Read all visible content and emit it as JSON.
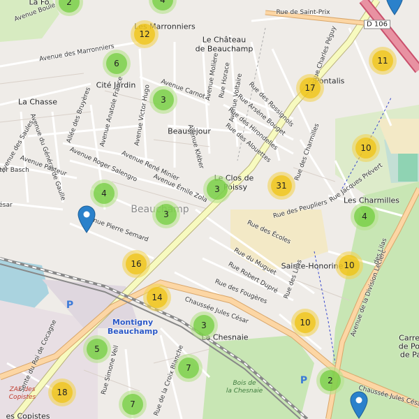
{
  "colors": {
    "green": "#6ecc39",
    "yellow": "#f0c20c",
    "pin": "#2a81cb",
    "road_major": "#f7fabf",
    "road_orange": "#fcd6a4",
    "rail": "#999999"
  },
  "places": [
    {
      "id": "marronniers",
      "text": "Les Marronniers"
    },
    {
      "id": "chateau1",
      "text": "Le Château"
    },
    {
      "id": "chateau2",
      "text": "de Beauchamp"
    },
    {
      "id": "citejardin",
      "text": "Cité Jardin"
    },
    {
      "id": "lachasse",
      "text": "La Chasse"
    },
    {
      "id": "beausejour",
      "text": "Beauséjour"
    },
    {
      "id": "leclos",
      "text": "Le Clos de"
    },
    {
      "id": "poissy",
      "text": "Poissy"
    },
    {
      "id": "pontalis",
      "text": "Pontalis"
    },
    {
      "id": "charmilles",
      "text": "Les Charmilles"
    },
    {
      "id": "honorine",
      "text": "Sainte-Honorine"
    },
    {
      "id": "chesnaie",
      "text": "La Chesnaie"
    },
    {
      "id": "carref1",
      "text": "Carref"
    },
    {
      "id": "carref2",
      "text": "de Pot"
    },
    {
      "id": "carref3",
      "text": "de Pa"
    },
    {
      "id": "lafo",
      "text": "La Fo"
    },
    {
      "id": "copistes",
      "text": "es Copistes"
    }
  ],
  "town_label": "Beauchamp",
  "station": [
    "Montigny",
    "Beauchamp"
  ],
  "wood": [
    "Bois de",
    "la Chesnaie"
  ],
  "zae": [
    "ZAE des",
    "Copistes"
  ],
  "road_shield": "D 106",
  "parking_symbol": "P",
  "streets": [
    {
      "id": "saintprix",
      "text": "Rue de Saint-Prix"
    },
    {
      "id": "marronniers_av",
      "text": "Avenue des Marronniers"
    },
    {
      "id": "boule",
      "text": "Avenue Boule"
    },
    {
      "id": "bruyeres",
      "text": "Allée des Bruyères"
    },
    {
      "id": "anatole",
      "text": "Avenue Anatole France"
    },
    {
      "id": "hugo",
      "text": "Avenue Victor Hugo"
    },
    {
      "id": "carnot",
      "text": "Avenue Carnot"
    },
    {
      "id": "moliere",
      "text": "Avenue Molière"
    },
    {
      "id": "horace",
      "text": "Rue Horace"
    },
    {
      "id": "voltaire",
      "text": "Avenue Voltaire"
    },
    {
      "id": "rossignols",
      "text": "Rue des Rossignols"
    },
    {
      "id": "arsene",
      "text": "Rue Arsène Bouget"
    },
    {
      "id": "hirondelles",
      "text": "Rue des Hirondelles"
    },
    {
      "id": "alouettes",
      "text": "Rue des Alouettes"
    },
    {
      "id": "charmilles_r",
      "text": "Rue des Charmilles"
    },
    {
      "id": "peguy",
      "text": "Avenue Charles Péguy"
    },
    {
      "id": "saules",
      "text": "Avenue des Saules"
    },
    {
      "id": "general",
      "text": "Avenue du Général de Gaulle"
    },
    {
      "id": "pasteur",
      "text": "Avenue Pasteur"
    },
    {
      "id": "salengro",
      "text": "Avenue Roger Salengro"
    },
    {
      "id": "miniere",
      "text": "Avenue René Minier"
    },
    {
      "id": "kleber",
      "text": "Avenue Kléber"
    },
    {
      "id": "zola",
      "text": "Avenue Émile Zola"
    },
    {
      "id": "semard",
      "text": "Avenue Pierre Semard"
    },
    {
      "id": "basch",
      "text": "ctor Basch"
    },
    {
      "id": "cesar_av",
      "text": "ésar"
    },
    {
      "id": "jacques",
      "text": "Rue Jacques Prévert"
    },
    {
      "id": "peupliers",
      "text": "Rue des Peupliers"
    },
    {
      "id": "ecoles",
      "text": "Rue des Écoles"
    },
    {
      "id": "muguet",
      "text": "Rue du Muguet"
    },
    {
      "id": "dupre",
      "text": "Rue Robert Dupré"
    },
    {
      "id": "fougeres",
      "text": "Rue des Fougères"
    },
    {
      "id": "lilas",
      "text": "Rue des Lilas"
    },
    {
      "id": "lilas2",
      "text": "des Lilas"
    },
    {
      "id": "leclerc",
      "text": "Avenue de la Division Leclerc"
    },
    {
      "id": "jules",
      "text": "Chaussée Jules César"
    },
    {
      "id": "jules2",
      "text": "Chaussée Jules César"
    },
    {
      "id": "simone",
      "text": "Rue Simone Veil"
    },
    {
      "id": "croix",
      "text": "Rue de la Croix Blanche"
    },
    {
      "id": "roi",
      "text": "Sente du Roi de Cocagne"
    }
  ],
  "clusters": [
    {
      "id": "c1",
      "count": "2",
      "tier": "green"
    },
    {
      "id": "c2",
      "count": "4",
      "tier": "green"
    },
    {
      "id": "c3",
      "count": "12",
      "tier": "yellow"
    },
    {
      "id": "c4",
      "count": "6",
      "tier": "green"
    },
    {
      "id": "c5",
      "count": "3",
      "tier": "green"
    },
    {
      "id": "c6",
      "count": "17",
      "tier": "yellow"
    },
    {
      "id": "c7",
      "count": "11",
      "tier": "yellow"
    },
    {
      "id": "c8",
      "count": "10",
      "tier": "yellow"
    },
    {
      "id": "c9",
      "count": "31",
      "tier": "yellow"
    },
    {
      "id": "c10",
      "count": "3",
      "tier": "green"
    },
    {
      "id": "c11",
      "count": "4",
      "tier": "green"
    },
    {
      "id": "c12",
      "count": "3",
      "tier": "green"
    },
    {
      "id": "c13",
      "count": "4",
      "tier": "green"
    },
    {
      "id": "c14",
      "count": "16",
      "tier": "yellow"
    },
    {
      "id": "c15",
      "count": "10",
      "tier": "yellow"
    },
    {
      "id": "c16",
      "count": "14",
      "tier": "yellow"
    },
    {
      "id": "c17",
      "count": "3",
      "tier": "green"
    },
    {
      "id": "c18",
      "count": "10",
      "tier": "yellow"
    },
    {
      "id": "c19",
      "count": "5",
      "tier": "green"
    },
    {
      "id": "c20",
      "count": "7",
      "tier": "green"
    },
    {
      "id": "c21",
      "count": "18",
      "tier": "yellow"
    },
    {
      "id": "c22",
      "count": "7",
      "tier": "green"
    },
    {
      "id": "c23",
      "count": "2",
      "tier": "green"
    }
  ],
  "markers": [
    {
      "id": "m1",
      "icon": "map-pin-icon"
    },
    {
      "id": "m2",
      "icon": "map-pin-icon"
    },
    {
      "id": "m3",
      "icon": "map-pin-icon"
    }
  ]
}
